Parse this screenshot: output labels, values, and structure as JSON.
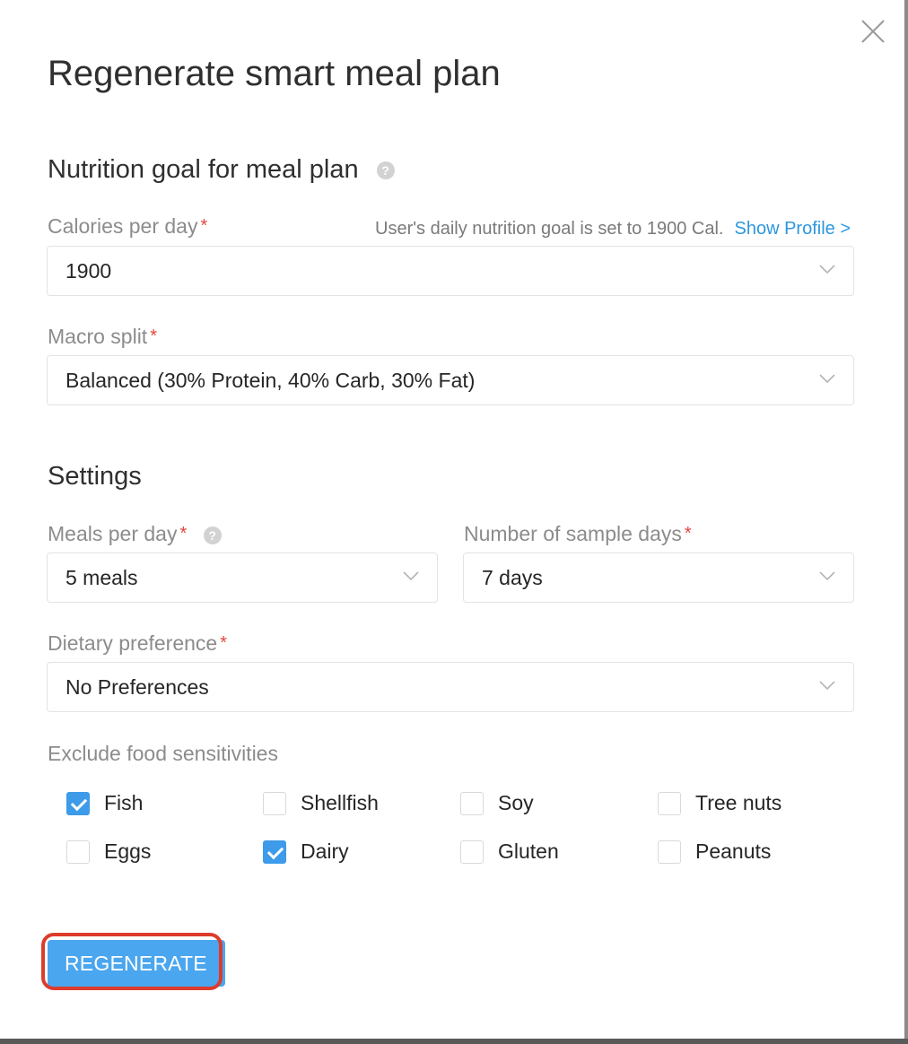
{
  "modal": {
    "title": "Regenerate smart meal plan",
    "close_icon": "close-icon"
  },
  "nutrition": {
    "section_title": "Nutrition goal for meal plan",
    "help_icon": "?",
    "calories": {
      "label": "Calories per day",
      "required_mark": "*",
      "hint": "User's daily nutrition goal is set to 1900 Cal.",
      "show_profile_link": "Show Profile >",
      "value": "1900"
    },
    "macro": {
      "label": "Macro split",
      "required_mark": "*",
      "value": "Balanced (30% Protein, 40% Carb, 30% Fat)"
    }
  },
  "settings": {
    "section_title": "Settings",
    "meals_per_day": {
      "label": "Meals per day",
      "required_mark": "*",
      "help_icon": "?",
      "value": "5 meals"
    },
    "sample_days": {
      "label": "Number of sample days",
      "required_mark": "*",
      "value": "7 days"
    },
    "dietary": {
      "label": "Dietary preference",
      "required_mark": "*",
      "value": "No Preferences"
    },
    "sensitivities": {
      "label": "Exclude food sensitivities",
      "items": [
        {
          "label": "Fish",
          "checked": true
        },
        {
          "label": "Shellfish",
          "checked": false
        },
        {
          "label": "Soy",
          "checked": false
        },
        {
          "label": "Tree nuts",
          "checked": false
        },
        {
          "label": "Eggs",
          "checked": false
        },
        {
          "label": "Dairy",
          "checked": true
        },
        {
          "label": "Gluten",
          "checked": false
        },
        {
          "label": "Peanuts",
          "checked": false
        }
      ]
    }
  },
  "actions": {
    "regenerate_label": "REGENERATE"
  },
  "colors": {
    "accent": "#3d9be9",
    "button": "#4aa6ee",
    "required": "#e5453f",
    "link": "#2d97e0",
    "highlight_outline": "#dd3b2c"
  }
}
